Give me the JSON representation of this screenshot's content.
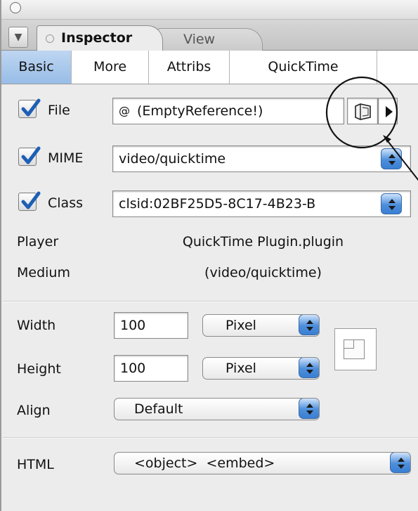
{
  "window": {
    "tabs": [
      {
        "label": "Inspector",
        "active": true
      },
      {
        "label": "View",
        "active": false
      }
    ]
  },
  "subtabs": [
    {
      "label": "Basic",
      "active": true
    },
    {
      "label": "More",
      "active": false
    },
    {
      "label": "Attribs",
      "active": false
    },
    {
      "label": "QuickTime",
      "active": false
    }
  ],
  "fields": {
    "file": {
      "label": "File",
      "checked": true,
      "value": "(EmptyReference!)",
      "icon": "at-icon"
    },
    "mime": {
      "label": "MIME",
      "checked": true,
      "value": "video/quicktime"
    },
    "class": {
      "label": "Class",
      "checked": true,
      "value": "clsid:02BF25D5-8C17-4B23-B"
    }
  },
  "info": {
    "player_label": "Player",
    "player_value": "QuickTime Plugin.plugin",
    "medium_label": "Medium",
    "medium_value": "(video/quicktime)"
  },
  "size": {
    "width_label": "Width",
    "width_value": "100",
    "width_unit": "Pixel",
    "height_label": "Height",
    "height_value": "100",
    "height_unit": "Pixel",
    "align_label": "Align",
    "align_value": "Default"
  },
  "html": {
    "label": "HTML",
    "value": "<object>  <embed>"
  },
  "colors": {
    "accent": "#5a95de",
    "subtab_active": "#a9c8ee",
    "panel_bg": "#ececec"
  }
}
